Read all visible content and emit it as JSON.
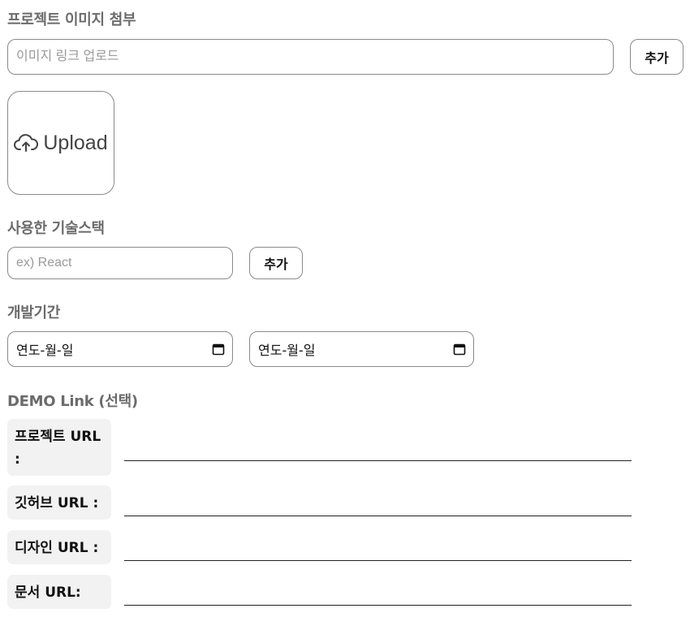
{
  "image_section": {
    "title": "프로젝트 이미지 첨부",
    "link_placeholder": "이미지 링크 업로드",
    "add_label": "추가",
    "upload_label": "Upload",
    "upload_icon": "cloud-upload-icon"
  },
  "stack_section": {
    "title": "사용한 기술스택",
    "placeholder": "ex) React",
    "add_label": "추가"
  },
  "period_section": {
    "title": "개발기간",
    "start_date_text": "연도-월-일",
    "end_date_text": "연도-월-일",
    "calendar_icon": "calendar-icon"
  },
  "demo_section": {
    "title": "DEMO Link (선택)",
    "fields": [
      {
        "label": "프로젝트 URL :",
        "value": ""
      },
      {
        "label": "깃허브 URL :",
        "value": ""
      },
      {
        "label": "디자인 URL :",
        "value": ""
      },
      {
        "label": "문서 URL:",
        "value": ""
      }
    ]
  }
}
